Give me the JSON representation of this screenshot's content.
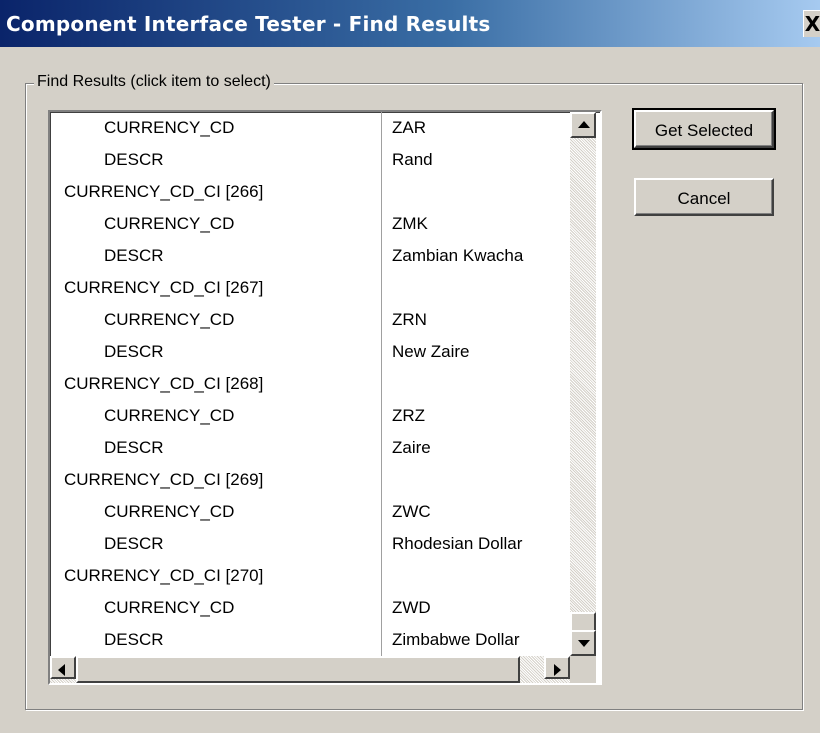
{
  "window": {
    "title": "Component Interface Tester - Find Results",
    "close_glyph": "X"
  },
  "group": {
    "label": "Find Results (click item to select)"
  },
  "list": {
    "rows": [
      {
        "name": "CURRENCY_CD",
        "value": "ZAR",
        "child": true
      },
      {
        "name": "DESCR",
        "value": "Rand",
        "child": true
      },
      {
        "name": "CURRENCY_CD_CI [266]",
        "value": "",
        "child": false
      },
      {
        "name": "CURRENCY_CD",
        "value": "ZMK",
        "child": true
      },
      {
        "name": "DESCR",
        "value": "Zambian Kwacha",
        "child": true
      },
      {
        "name": "CURRENCY_CD_CI [267]",
        "value": "",
        "child": false
      },
      {
        "name": "CURRENCY_CD",
        "value": "ZRN",
        "child": true
      },
      {
        "name": "DESCR",
        "value": "New Zaire",
        "child": true
      },
      {
        "name": "CURRENCY_CD_CI [268]",
        "value": "",
        "child": false
      },
      {
        "name": "CURRENCY_CD",
        "value": "ZRZ",
        "child": true
      },
      {
        "name": "DESCR",
        "value": "Zaire",
        "child": true
      },
      {
        "name": "CURRENCY_CD_CI [269]",
        "value": "",
        "child": false
      },
      {
        "name": "CURRENCY_CD",
        "value": "ZWC",
        "child": true
      },
      {
        "name": "DESCR",
        "value": "Rhodesian Dollar",
        "child": true
      },
      {
        "name": "CURRENCY_CD_CI [270]",
        "value": "",
        "child": false
      },
      {
        "name": "CURRENCY_CD",
        "value": "ZWD",
        "child": true
      },
      {
        "name": "DESCR",
        "value": "Zimbabwe Dollar",
        "child": true
      }
    ]
  },
  "buttons": {
    "get_selected": "Get Selected",
    "cancel": "Cancel"
  },
  "icons": {
    "close": "close-icon",
    "scroll_up": "arrow-up-icon",
    "scroll_down": "arrow-down-icon",
    "scroll_left": "arrow-left-icon",
    "scroll_right": "arrow-right-icon"
  },
  "colors": {
    "title_start": "#0a246a",
    "title_end": "#a6caf0",
    "dialog_face": "#d4d0c8"
  }
}
